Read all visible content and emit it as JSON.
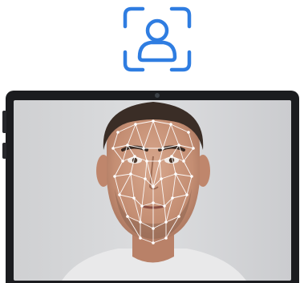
{
  "icons": {
    "face_id": "face-id-icon",
    "camera": "front-camera-icon"
  },
  "colors": {
    "accent": "#2f7de1",
    "device_frame": "#1b1c1f",
    "mesh": "#ffffff"
  }
}
